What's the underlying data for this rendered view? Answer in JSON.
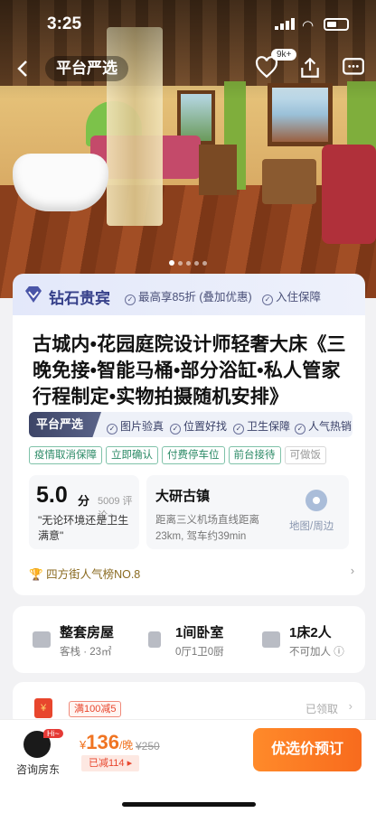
{
  "status_bar": {
    "time": "3:25"
  },
  "nav": {
    "brand": "平台严选",
    "favorite_count": "9k+"
  },
  "gallery": {
    "total_images": 5,
    "current_index": 1
  },
  "member": {
    "label": "钻石贵宾",
    "perks": [
      "最高享85折 (叠加优惠)",
      "入住保障"
    ]
  },
  "listing": {
    "title": "古城内•花园庭院设计师轻奢大床《三晚免接•智能马桶•部分浴缸•私人管家行程制定•实物拍摄随机安排》",
    "guarantee_brand": "平台严选",
    "guarantees": [
      "图片验真",
      "位置好找",
      "卫生保障",
      "人气热销"
    ],
    "tags": [
      "疫情取消保障",
      "立即确认",
      "付费停车位",
      "前台接待",
      "可做饭"
    ],
    "rating": {
      "score": "5.0",
      "unit": "分",
      "reviews": "5009 评论",
      "quote": "\"无论环境还是卫生满意\""
    },
    "location": {
      "name": "大研古镇",
      "distance": "距离三义机场直线距离23km, 驾车约39min",
      "map_label": "地图/周边"
    },
    "rank": "四方街人气榜NO.8"
  },
  "room": {
    "type": {
      "title": "整套房屋",
      "sub": "客栈 · 23㎡"
    },
    "bedrooms": {
      "title": "1间卧室",
      "sub": "0厅1卫0厨"
    },
    "beds": {
      "title": "1床2人",
      "sub": "不可加人"
    }
  },
  "coupon": {
    "badge": "满100减5",
    "status": "已领取"
  },
  "bottom": {
    "ask_label": "咨询房东",
    "hi": "Hi~",
    "currency": "¥",
    "price": "136",
    "per": "/晚",
    "original": "¥250",
    "saved": "已减114 ▸",
    "book_label": "优选价预订"
  }
}
